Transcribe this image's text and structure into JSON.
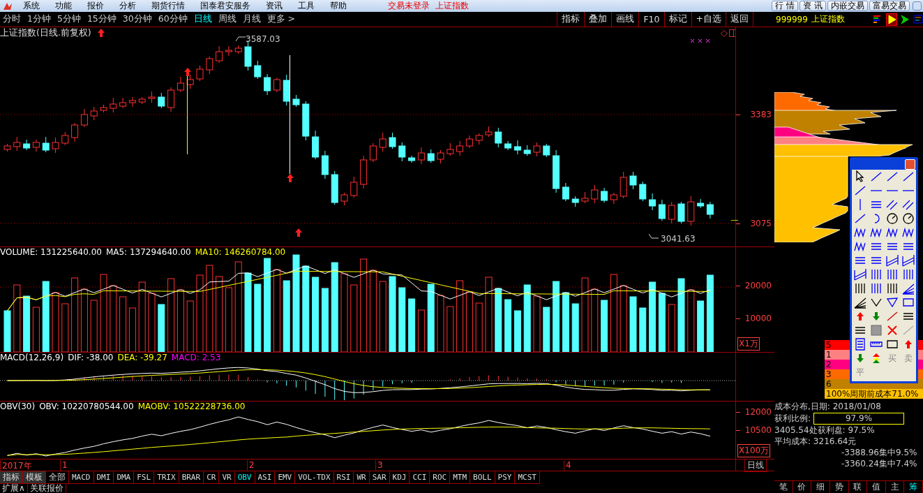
{
  "menu_bar": {
    "items": [
      "系统",
      "功能",
      "报价",
      "分析",
      "期货行情",
      "国泰君安服务",
      "资讯",
      "工具",
      "帮助"
    ],
    "status": [
      "交易未登录",
      "上证指数"
    ],
    "buttons": [
      "行 情",
      "资 讯",
      "内嵌交易",
      "富易交易"
    ]
  },
  "periods": [
    {
      "label": "分时",
      "selected": false
    },
    {
      "label": "1分钟",
      "selected": false
    },
    {
      "label": "5分钟",
      "selected": false
    },
    {
      "label": "15分钟",
      "selected": false
    },
    {
      "label": "30分钟",
      "selected": false
    },
    {
      "label": "60分钟",
      "selected": false
    },
    {
      "label": "日线",
      "selected": true
    },
    {
      "label": "周线",
      "selected": false
    },
    {
      "label": "月线",
      "selected": false
    },
    {
      "label": "更多 >",
      "selected": false
    }
  ],
  "chart_toolbar": [
    "指标",
    "叠加",
    "画线",
    "F10",
    "标记",
    "+自选",
    "返回"
  ],
  "main_chart": {
    "title": "上证指数(日线.前复权)",
    "high_label": "3587.03",
    "low_label": "3041.63",
    "y_labels": [
      "3383",
      "3075"
    ]
  },
  "volume": {
    "legend": [
      {
        "text": "VOLUME: 131225640.00",
        "color": "#ffffff"
      },
      {
        "text": "MA5: 137294640.00",
        "color": "#ffffff"
      },
      {
        "text": "MA10: 146260784.00",
        "color": "#ffff00"
      }
    ],
    "y_labels": [
      "20000",
      "10000"
    ],
    "unit": "X1万"
  },
  "macd": {
    "legend": [
      {
        "text": "MACD(12,26,9)",
        "color": "#ffffff"
      },
      {
        "text": "DIF: -38.00",
        "color": "#ffffff"
      },
      {
        "text": "DEA: -39.27",
        "color": "#ffff00"
      },
      {
        "text": "MACD: 2.53",
        "color": "#ff00ff"
      }
    ]
  },
  "obv": {
    "legend": [
      {
        "text": "OBV(30)",
        "color": "#ffffff"
      },
      {
        "text": "OBV: 10220780544.00",
        "color": "#ffffff"
      },
      {
        "text": "MAOBV: 10522228736.00",
        "color": "#ffff00"
      }
    ],
    "y_labels": [
      "12000",
      "10500"
    ],
    "unit": "X100万"
  },
  "date_axis": {
    "labels": [
      "2017年",
      "1",
      "2",
      "3",
      "4"
    ],
    "period": "日线"
  },
  "indicator_tabs": [
    {
      "label": "指标",
      "selected": false
    },
    {
      "label": "模板",
      "selected": false
    },
    {
      "label": "全部",
      "selected": false
    },
    {
      "label": "MACD",
      "selected": false
    },
    {
      "label": "DMI",
      "selected": false
    },
    {
      "label": "DMA",
      "selected": false
    },
    {
      "label": "FSL",
      "selected": false
    },
    {
      "label": "TRIX",
      "selected": false
    },
    {
      "label": "BRAR",
      "selected": false
    },
    {
      "label": "CR",
      "selected": false
    },
    {
      "label": "VR",
      "selected": false
    },
    {
      "label": "OBV",
      "selected": true
    },
    {
      "label": "ASI",
      "selected": false
    },
    {
      "label": "EMV",
      "selected": false
    },
    {
      "label": "VOL-TDX",
      "selected": false
    },
    {
      "label": "RSI",
      "selected": false
    },
    {
      "label": "WR",
      "selected": false
    },
    {
      "label": "SAR",
      "selected": false
    },
    {
      "label": "KDJ",
      "selected": false
    },
    {
      "label": "CCI",
      "selected": false
    },
    {
      "label": "ROC",
      "selected": false
    },
    {
      "label": "MTM",
      "selected": false
    },
    {
      "label": "BOLL",
      "selected": false
    },
    {
      "label": "PSY",
      "selected": false
    },
    {
      "label": "MCST",
      "selected": false
    }
  ],
  "bottom_tabs": [
    "扩展∧",
    "关联报价"
  ],
  "side_panel": {
    "code": "999999",
    "name": "上证指数",
    "chip_legend": [
      {
        "label": "5",
        "color": "#ff0000"
      },
      {
        "label": "1",
        "color": "#ff8080"
      },
      {
        "label": "2",
        "color": "#ff0080"
      },
      {
        "label": "3",
        "color": "#ff6a00"
      },
      {
        "label": "6",
        "color": "#c08000"
      },
      {
        "label": "100%周期前成本71.0%",
        "color": "#ffc000"
      }
    ],
    "stats_title": "成本分布,日期: 2018/01/08",
    "profit_label": "获利比例:",
    "profit_value": "97.9%",
    "stats_lines": [
      "3405.54处获利盘: 97.5%",
      "平均成本: 3216.64元",
      "-3388.96集中9.5%",
      "-3360.24集中7.4%"
    ],
    "tabs": [
      {
        "label": "笔",
        "selected": false
      },
      {
        "label": "价",
        "selected": false
      },
      {
        "label": "细",
        "selected": false
      },
      {
        "label": "势",
        "selected": false
      },
      {
        "label": "联",
        "selected": false
      },
      {
        "label": "值",
        "selected": false
      },
      {
        "label": "主",
        "selected": false
      },
      {
        "label": "筹",
        "selected": true
      }
    ]
  },
  "toolbox": {
    "text_tools": [
      {
        "label": "买",
        "disabled": true
      },
      {
        "label": "卖",
        "disabled": true
      },
      {
        "label": "平",
        "disabled": true
      }
    ]
  }
}
